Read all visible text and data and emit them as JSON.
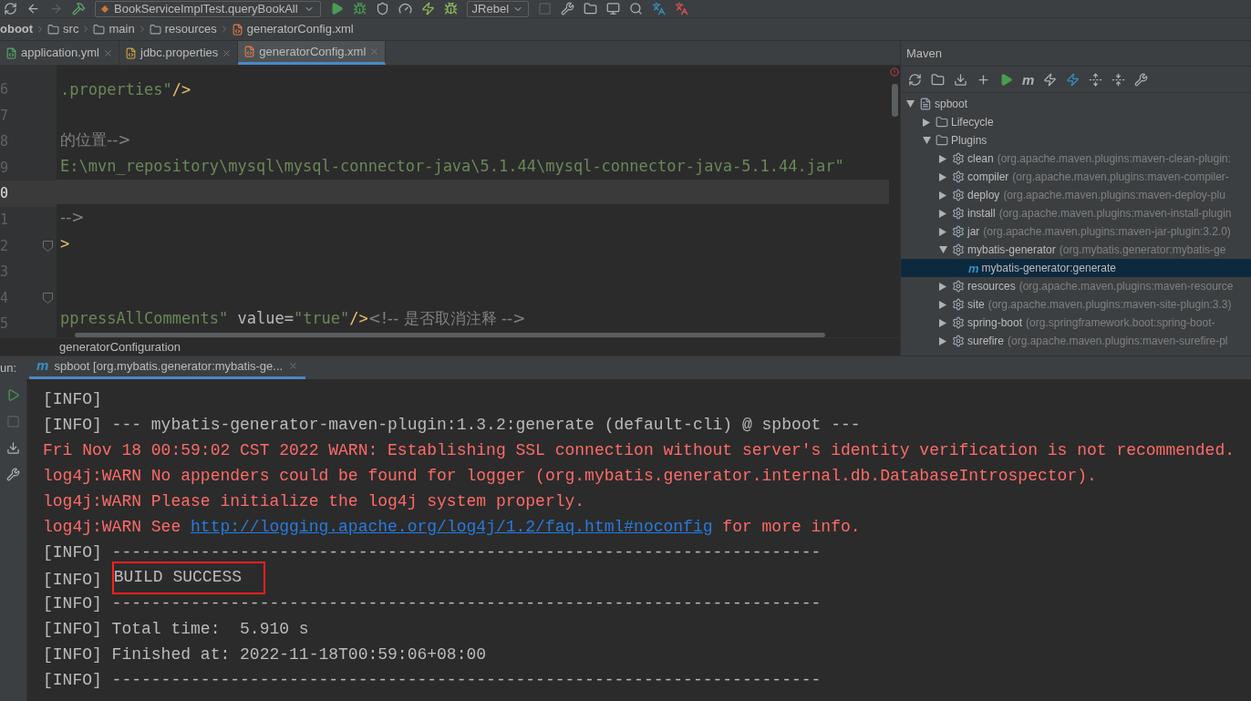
{
  "toolbar": {
    "run_config": "BookServiceImplTest.queryBookAll",
    "jrebel": "JRebel"
  },
  "breadcrumb": [
    "oboot",
    "src",
    "main",
    "resources",
    "generatorConfig.xml"
  ],
  "tabs": [
    {
      "label": "application.yml",
      "selected": false
    },
    {
      "label": "jdbc.properties",
      "selected": false
    },
    {
      "label": "generatorConfig.xml",
      "selected": true
    }
  ],
  "editor": {
    "lines": [
      {
        "number": "6",
        "current": false,
        "fold": false,
        "parts": [
          {
            "kind": "string",
            "text": ".properties\""
          },
          {
            "kind": "tag",
            "text": "/>"
          }
        ]
      },
      {
        "number": "7",
        "current": false,
        "fold": false
      },
      {
        "number": "8",
        "current": false,
        "fold": false,
        "parts": [
          {
            "kind": "comment",
            "text": "的位置-->"
          }
        ]
      },
      {
        "number": "9",
        "current": false,
        "fold": false,
        "parts": [
          {
            "kind": "string",
            "text": "E:\\mvn_repository\\mysql\\mysql-connector-java\\5.1.44\\mysql-connector-java-5.1.44.jar\""
          }
        ]
      },
      {
        "number": "0",
        "current": true,
        "fold": false
      },
      {
        "number": "1",
        "current": false,
        "fold": false,
        "parts": [
          {
            "kind": "comment",
            "text": "-->"
          }
        ]
      },
      {
        "number": "2",
        "current": false,
        "fold": true,
        "parts": [
          {
            "kind": "tag",
            "text": ">"
          }
        ]
      },
      {
        "number": "3",
        "current": false,
        "fold": false
      },
      {
        "number": "4",
        "current": false,
        "fold": true
      },
      {
        "number": "5",
        "current": false,
        "fold": false,
        "parts": [
          {
            "kind": "string",
            "text": "ppressAllComments\""
          },
          {
            "kind": "attr",
            "text": " value="
          },
          {
            "kind": "string",
            "text": "\"true\""
          },
          {
            "kind": "tag",
            "text": "/>"
          },
          {
            "kind": "comment",
            "text": "<!-- 是否取消注释 -->"
          }
        ]
      }
    ],
    "path": "generatorConfiguration"
  },
  "maven": {
    "title": "Maven",
    "toolbar_goal_icon": "m",
    "tree": [
      {
        "name": "spboot",
        "kind": "project",
        "expanded": true,
        "selected": false,
        "children": [
          {
            "name": "Lifecycle",
            "kind": "folder",
            "expanded": false,
            "selected": false
          },
          {
            "name": "Plugins",
            "kind": "folder",
            "expanded": true,
            "selected": false,
            "children": [
              {
                "name": "clean",
                "detail": "(org.apache.maven.plugins:maven-clean-plugin:",
                "kind": "plugin",
                "expanded": false,
                "selected": false
              },
              {
                "name": "compiler",
                "detail": "(org.apache.maven.plugins:maven-compiler-",
                "kind": "plugin",
                "expanded": false,
                "selected": false
              },
              {
                "name": "deploy",
                "detail": "(org.apache.maven.plugins:maven-deploy-plu",
                "kind": "plugin",
                "expanded": false,
                "selected": false
              },
              {
                "name": "install",
                "detail": "(org.apache.maven.plugins:maven-install-plugin",
                "kind": "plugin",
                "expanded": false,
                "selected": false
              },
              {
                "name": "jar",
                "detail": "(org.apache.maven.plugins:maven-jar-plugin:3.2.0)",
                "kind": "plugin",
                "expanded": false,
                "selected": false
              },
              {
                "name": "mybatis-generator",
                "detail": "(org.mybatis.generator:mybatis-ge",
                "kind": "plugin",
                "expanded": true,
                "selected": false,
                "children": [
                  {
                    "name": "mybatis-generator:generate",
                    "icon": "m",
                    "kind": "goal",
                    "selected": true
                  }
                ]
              },
              {
                "name": "resources",
                "detail": "(org.apache.maven.plugins:maven-resource",
                "kind": "plugin",
                "expanded": false,
                "selected": false
              },
              {
                "name": "site",
                "detail": "(org.apache.maven.plugins:maven-site-plugin:3.3)",
                "kind": "plugin",
                "expanded": false,
                "selected": false
              },
              {
                "name": "spring-boot",
                "detail": "(org.springframework.boot:spring-boot-",
                "kind": "plugin",
                "expanded": false,
                "selected": false
              },
              {
                "name": "surefire",
                "detail": "(org.apache.maven.plugins:maven-surefire-pl",
                "kind": "plugin",
                "expanded": false,
                "selected": false
              }
            ]
          }
        ]
      }
    ]
  },
  "run": {
    "label": "un:",
    "tab_icon": "m",
    "tab": "spboot [org.mybatis.generator:mybatis-ge...",
    "lines": [
      {
        "kind": "info",
        "parts": [
          {
            "kind": "text",
            "text": "[INFO]"
          }
        ]
      },
      {
        "kind": "info",
        "parts": [
          {
            "kind": "text",
            "text": "[INFO] --- mybatis-generator-maven-plugin:1.3.2:generate (default-cli) @ spboot ---"
          }
        ]
      },
      {
        "kind": "warn",
        "parts": [
          {
            "kind": "text",
            "text": "Fri Nov 18 00:59:02 CST 2022 WARN: Establishing SSL connection without server's identity verification is not recommended."
          }
        ]
      },
      {
        "kind": "warn",
        "parts": [
          {
            "kind": "text",
            "text": "log4j:WARN No appenders could be found for logger (org.mybatis.generator.internal.db.DatabaseIntrospector)."
          }
        ]
      },
      {
        "kind": "warn",
        "parts": [
          {
            "kind": "text",
            "text": "log4j:WARN Please initialize the log4j system properly."
          }
        ]
      },
      {
        "kind": "warn",
        "parts": [
          {
            "kind": "text",
            "text": "log4j:WARN See "
          },
          {
            "kind": "link",
            "text": "http://logging.apache.org/log4j/1.2/faq.html#noconfig"
          },
          {
            "kind": "text",
            "text": " for more info."
          }
        ]
      },
      {
        "kind": "info",
        "parts": [
          {
            "kind": "text",
            "text": "[INFO] ------------------------------------------------------------------------"
          }
        ]
      },
      {
        "kind": "info",
        "parts": [
          {
            "kind": "text",
            "text": "[INFO] "
          },
          {
            "kind": "boxed",
            "text": "BUILD SUCCESS"
          }
        ]
      },
      {
        "kind": "info",
        "parts": [
          {
            "kind": "text",
            "text": "[INFO] ------------------------------------------------------------------------"
          }
        ]
      },
      {
        "kind": "info",
        "parts": [
          {
            "kind": "text",
            "text": "[INFO] Total time:  5.910 s"
          }
        ]
      },
      {
        "kind": "info",
        "parts": [
          {
            "kind": "text",
            "text": "[INFO] Finished at: 2022-11-18T00:59:06+08:00"
          }
        ]
      },
      {
        "kind": "info",
        "parts": [
          {
            "kind": "text",
            "text": "[INFO] ------------------------------------------------------------------------"
          }
        ]
      }
    ]
  }
}
